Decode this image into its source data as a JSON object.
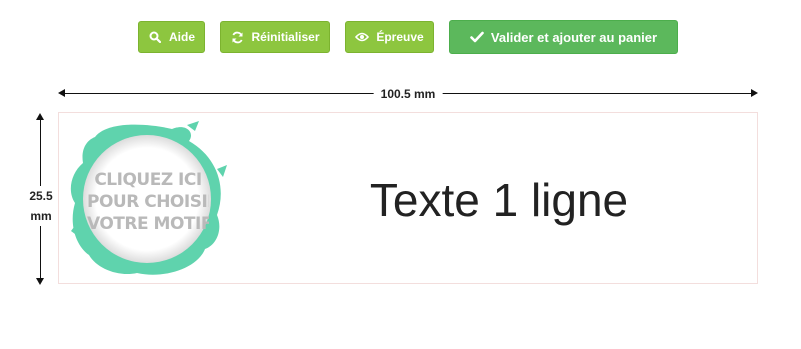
{
  "toolbar": {
    "help_label": "Aide",
    "reset_label": "Réinitialiser",
    "proof_label": "Épreuve",
    "validate_label": "Valider et ajouter au panier",
    "button_color": "#8dc63f",
    "validate_color": "#5cb85c"
  },
  "dimensions": {
    "width_label": "100.5 mm",
    "height_value": "25.5",
    "height_unit": "mm"
  },
  "plate": {
    "motif_lines": [
      "CLIQUEZ ICI",
      "POUR CHOISIR",
      "VOTRE MOTIF"
    ],
    "motif_color": "#5fd3ad",
    "text": "Texte 1 ligne"
  }
}
